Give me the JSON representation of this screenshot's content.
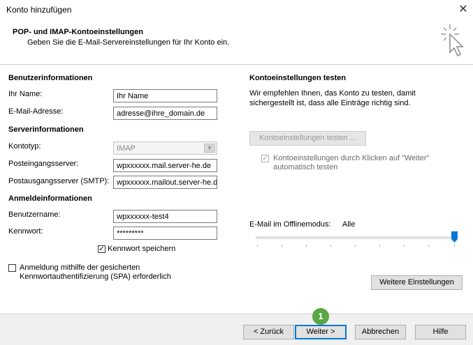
{
  "window": {
    "title": "Konto hinzufügen",
    "close_glyph": "✕"
  },
  "header": {
    "title": "POP- und IMAP-Kontoeinstellungen",
    "subtitle": "Geben Sie die E-Mail-Servereinstellungen für Ihr Konto ein.",
    "icon": "cursor-click-icon"
  },
  "user_info": {
    "section": "Benutzerinformationen",
    "name_label": "Ihr Name:",
    "name_value": "Ihr Name",
    "email_label": "E-Mail-Adresse:",
    "email_value": "adresse@ihre_domain.de"
  },
  "server_info": {
    "section": "Serverinformationen",
    "type_label": "Kontotyp:",
    "type_value": "IMAP",
    "incoming_label": "Posteingangsserver:",
    "incoming_value": "wpxxxxxx.mail.server-he.de",
    "outgoing_label": "Postausgangsserver (SMTP):",
    "outgoing_value": "wpxxxxxx.mailout.server-he.de"
  },
  "login_info": {
    "section": "Anmeldeinformationen",
    "username_label": "Benutzername:",
    "username_value": "wpxxxxxx-test4",
    "password_label": "Kennwort:",
    "password_value": "*********",
    "remember_label": "Kennwort speichern",
    "remember_checked": true,
    "spa_label_line1": "Anmeldung mithilfe der gesicherten",
    "spa_label_line2": "Kennwortauthentifizierung (SPA) erforderlich",
    "spa_checked": false
  },
  "test_panel": {
    "section": "Kontoeinstellungen testen",
    "desc_line1": "Wir empfehlen Ihnen, das Konto zu testen, damit",
    "desc_line2": "sichergestellt ist, dass alle Einträge richtig sind.",
    "test_button": "Kontoeinstellungen testen ...",
    "auto_test_line1": "Kontoeinstellungen durch Klicken auf \"Weiter\"",
    "auto_test_line2": "automatisch testen",
    "auto_test_checked": true
  },
  "offline": {
    "label": "E-Mail im Offlinemodus:",
    "value": "Alle",
    "slider_level": 1.0
  },
  "buttons": {
    "more_settings": "Weitere Einstellungen",
    "back": "< Zurück",
    "next": "Weiter >",
    "cancel": "Abbrechen",
    "help": "Hilfe"
  },
  "annotation": {
    "badge": "1",
    "color": "#5aa845"
  },
  "colors": {
    "primary_border": "#0078d7",
    "slider_thumb": "#0078d7"
  }
}
